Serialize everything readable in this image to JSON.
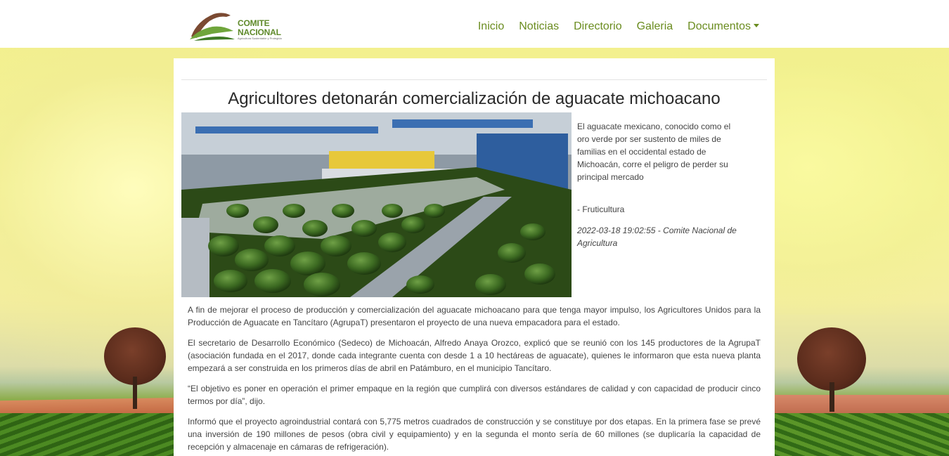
{
  "nav": {
    "logo_line1": "COMITE",
    "logo_line2": "NACIONAL",
    "logo_tagline": "Agricultura Sustentable y Protegida",
    "items": [
      {
        "label": "Inicio"
      },
      {
        "label": "Noticias"
      },
      {
        "label": "Directorio"
      },
      {
        "label": "Galeria"
      },
      {
        "label": "Documentos"
      }
    ],
    "accent_color": "#6a8c1f"
  },
  "article": {
    "title": "Agricultores detonarán comercialización de aguacate michoacano",
    "summary": "El aguacate mexicano, conocido como el oro verde por ser sustento de miles de familias en el occidental estado de Michoacán, corre el peligro de perder su principal mercado",
    "category": "- Fruticultura",
    "meta": "2022-03-18 19:02:55 - Comite Nacional de Agricultura",
    "paragraphs": [
      "A fin de mejorar el proceso de producción y comercialización del aguacate michoacano para que tenga mayor impulso, los Agricultores Unidos para la Producción de Aguacate en Tancítaro (AgrupaT) presentaron el proyecto de una nueva empacadora para el estado.",
      "El secretario de Desarrollo Económico (Sedeco) de Michoacán, Alfredo Anaya Orozco, explicó que se reunió con los 145 productores de la AgrupaT (asociación fundada en el 2017, donde cada integrante cuenta con desde 1 a 10 hectáreas de aguacate), quienes le informaron que esta nueva planta empezará a ser construida en los primeros días de abril en Patámburo, en el municipio Tancítaro.",
      "“El objetivo es poner en operación el primer empaque en la región que cumplirá con diversos estándares de calidad y con capacidad de producir cinco termos por día”, dijo.",
      "Informó que el proyecto agroindustrial contará con 5,775 metros cuadrados de construcción y se constituye por dos etapas. En la primera fase se prevé una inversión de 190 millones de pesos (obra civil y equipamiento) y en la segunda el monto sería de 60 millones (se duplicaría la capacidad de recepción y almacenaje en cámaras de refrigeración)."
    ]
  }
}
